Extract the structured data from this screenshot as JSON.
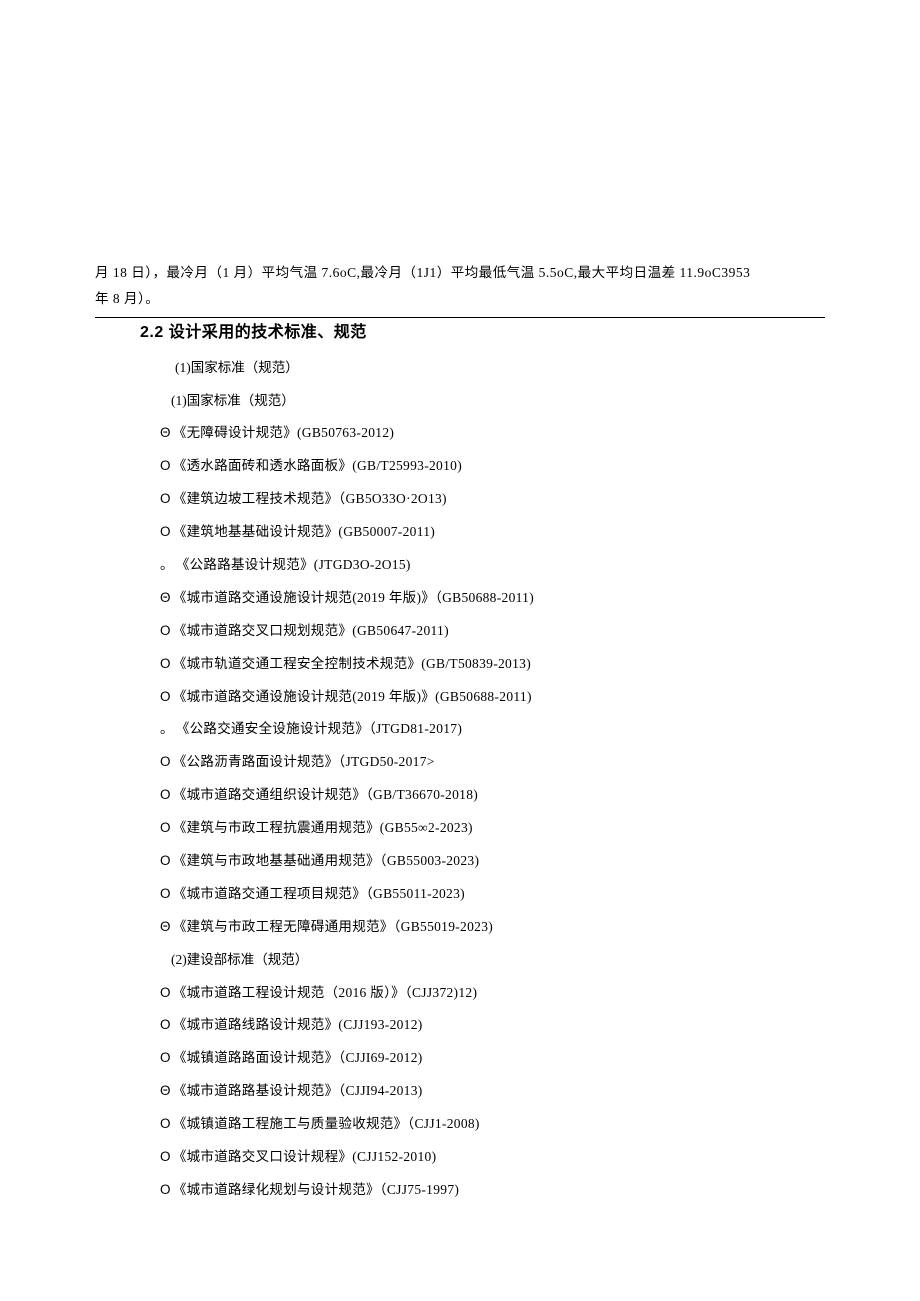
{
  "intro_line1": "月 18 日），最冷月（1 月）平均气温 7.6oC,最冷月（1J1）平均最低气温 5.5oC,最大平均日温差 11.9oC3953",
  "intro_line2": "年 8 月）。",
  "section_title": "2.2 设计采用的技术标准、规范",
  "sub1a": "(1)国家标准（规范）",
  "sub1b": "(1)国家标准（规范）",
  "items1": [
    {
      "b": "Θ",
      "t": "《无障碍设计规范》(GB50763-2012)"
    },
    {
      "b": "O",
      "t": "《透水路面砖和透水路面板》(GB/T25993-2010)"
    },
    {
      "b": "O",
      "t": "《建筑边坡工程技术规范》（GB5O33O·2O13)"
    },
    {
      "b": "O",
      "t": "《建筑地基基础设计规范》(GB50007-2011)"
    },
    {
      "b": "。",
      "t": "《公路路基设计规范》(JTGD3O-2O15)"
    },
    {
      "b": "Θ",
      "t": "《城市道路交通设施设计规范(2019 年版)》（GB50688-2011)"
    },
    {
      "b": "O",
      "t": "《城市道路交叉口规划规范》(GB50647-2011)"
    },
    {
      "b": "O",
      "t": "《城市轨道交通工程安全控制技术规范》(GB/T50839-2013)"
    },
    {
      "b": "O",
      "t": "《城市道路交通设施设计规范(2019 年版)》(GB50688-2011)"
    },
    {
      "b": "。",
      "t": "《公路交通安全设施设计规范》（JTGD81-2017)"
    },
    {
      "b": "O",
      "t": "《公路沥青路面设计规范》（JTGD50-2017>"
    },
    {
      "b": "O",
      "t": "《城市道路交通组织设计规范》（GB/T36670-2018)"
    },
    {
      "b": "O",
      "t": "《建筑与市政工程抗震通用规范》(GB55∞2-2023)"
    },
    {
      "b": "O",
      "t": "《建筑与市政地基基础通用规范》（GB55003-2023)"
    },
    {
      "b": "O",
      "t": "《城市道路交通工程项目规范》（GB55011-2023)"
    },
    {
      "b": "Θ",
      "t": "《建筑与市政工程无障碍通用规范》（GB55019-2023)"
    }
  ],
  "sub2": "(2)建设部标准（规范）",
  "items2": [
    {
      "b": "O",
      "t": "《城市道路工程设计规范（2016 版）》（CJJ372)12)"
    },
    {
      "b": "O",
      "t": "《城市道路线路设计规范》(CJJ193-2012)"
    },
    {
      "b": "O",
      "t": "《城镇道路路面设计规范》（CJJI69-2012)"
    },
    {
      "b": "Θ",
      "t": "《城市道路路基设计规范》（CJJI94-2013)"
    },
    {
      "b": "O",
      "t": "《城镇道路工程施工与质量验收规范》（CJJ1-2008)"
    },
    {
      "b": "O",
      "t": "《城市道路交叉口设计规程》(CJJ152-2010)"
    },
    {
      "b": "O",
      "t": "《城市道路绿化规划与设计规范》（CJJ75-1997)"
    }
  ]
}
